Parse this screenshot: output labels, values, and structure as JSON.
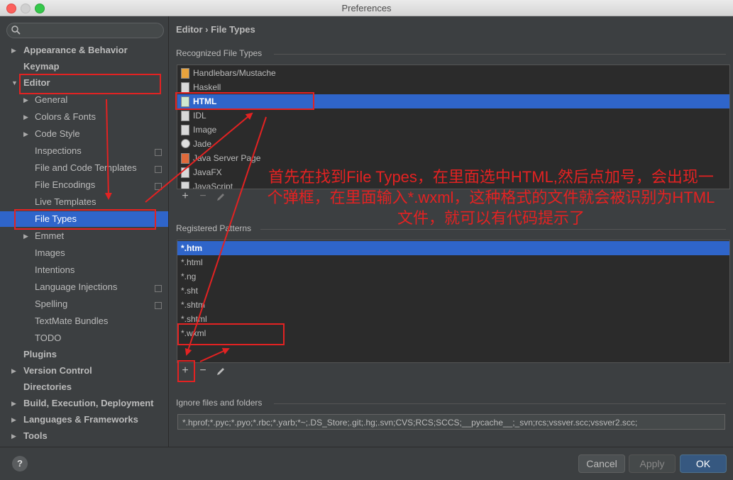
{
  "window": {
    "title": "Preferences"
  },
  "sidebar": {
    "search_placeholder": "",
    "items": [
      {
        "label": "Appearance & Behavior",
        "expanded": false
      },
      {
        "label": "Keymap"
      },
      {
        "label": "Editor",
        "expanded": true
      },
      {
        "label": "General"
      },
      {
        "label": "Colors & Fonts"
      },
      {
        "label": "Code Style"
      },
      {
        "label": "Inspections"
      },
      {
        "label": "File and Code Templates"
      },
      {
        "label": "File Encodings"
      },
      {
        "label": "Live Templates"
      },
      {
        "label": "File Types",
        "selected": true
      },
      {
        "label": "Emmet"
      },
      {
        "label": "Images"
      },
      {
        "label": "Intentions"
      },
      {
        "label": "Language Injections"
      },
      {
        "label": "Spelling"
      },
      {
        "label": "TextMate Bundles"
      },
      {
        "label": "TODO"
      },
      {
        "label": "Plugins"
      },
      {
        "label": "Version Control"
      },
      {
        "label": "Directories"
      },
      {
        "label": "Build, Execution, Deployment"
      },
      {
        "label": "Languages & Frameworks"
      },
      {
        "label": "Tools"
      }
    ]
  },
  "main": {
    "breadcrumb": "Editor › File Types",
    "recognized": {
      "title": "Recognized File Types",
      "items": [
        {
          "label": "Handlebars/Mustache",
          "icon": "handlebars-icon"
        },
        {
          "label": "Haskell",
          "icon": "file-icon"
        },
        {
          "label": "HTML",
          "icon": "html-file-icon",
          "selected": true
        },
        {
          "label": "IDL",
          "icon": "idl-icon"
        },
        {
          "label": "Image",
          "icon": "image-file-icon"
        },
        {
          "label": "Jade",
          "icon": "jade-icon"
        },
        {
          "label": "Java Server Page",
          "icon": "jsp-icon"
        },
        {
          "label": "JavaFX",
          "icon": "javafx-icon"
        },
        {
          "label": "JavaScript",
          "icon": "javascript-icon"
        }
      ]
    },
    "patterns": {
      "title": "Registered Patterns",
      "items": [
        {
          "label": "*.htm",
          "selected": true
        },
        {
          "label": "*.html"
        },
        {
          "label": "*.ng"
        },
        {
          "label": "*.sht"
        },
        {
          "label": "*.shtm"
        },
        {
          "label": "*.shtml"
        },
        {
          "label": "*.wxml"
        }
      ]
    },
    "ignore": {
      "title": "Ignore files and folders",
      "value": "*.hprof;*.pyc;*.pyo;*.rbc;*.yarb;*~;.DS_Store;.git;.hg;.svn;CVS;RCS;SCCS;__pycache__;_svn;rcs;vssver.scc;vssver2.scc;"
    },
    "toolbar": {
      "add": "+",
      "remove": "−"
    }
  },
  "annotation": {
    "text": "首先在找到File Types，在里面选中HTML,然后点加号，会出现一个弹框，在里面输入*.wxml，这种格式的文件就会被识别为HTML文件，就可以有代码提示了",
    "color": "#e32222"
  },
  "buttons": {
    "help": "?",
    "cancel": "Cancel",
    "apply": "Apply",
    "ok": "OK"
  },
  "colors": {
    "selection": "#2f65ca",
    "panel": "#3c3f41",
    "list_bg": "#2b2b2b",
    "ok_button": "#365880"
  }
}
